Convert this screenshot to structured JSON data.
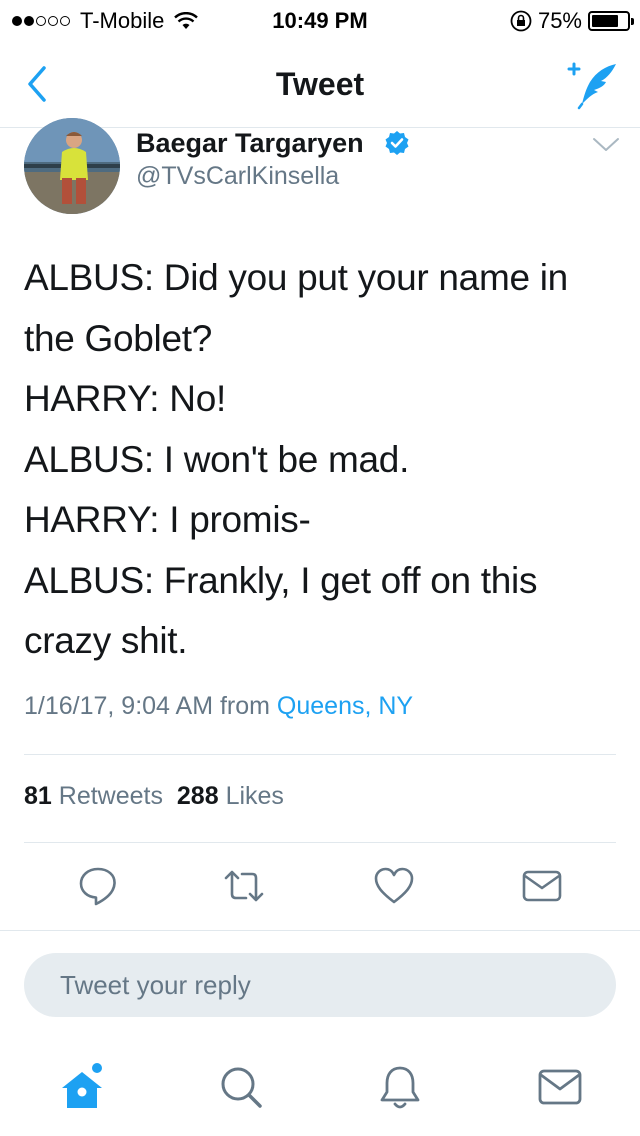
{
  "status_bar": {
    "carrier": "T-Mobile",
    "time": "10:49 PM",
    "battery": "75%",
    "signal_bars_filled": 2,
    "signal_bars_total": 5,
    "battery_level": 0.75
  },
  "nav": {
    "title": "Tweet",
    "back_icon": "chevron-left-icon",
    "compose_icon": "compose-tweet-icon"
  },
  "tweet": {
    "author_name": "Baegar Targaryen",
    "author_handle": "@TVsCarlKinsella",
    "verified": true,
    "text_lines": [
      "ALBUS: Did you put your name in",
      "the Goblet?",
      "HARRY: No!",
      "ALBUS: I won't be mad.",
      "HARRY: I promis-",
      "ALBUS: Frankly, I get off on this",
      "crazy shit."
    ],
    "timestamp": "1/16/17, 9:04 AM from ",
    "location": "Queens, NY",
    "retweets_count": "81",
    "retweets_label": "Retweets",
    "likes_count": "288",
    "likes_label": "Likes"
  },
  "reply": {
    "placeholder": "Tweet your reply"
  },
  "colors": {
    "accent": "#1da1f2",
    "secondary_text": "#657786",
    "divider": "#e1e8ed",
    "reply_bg": "#e6ecf0"
  },
  "tabs": [
    {
      "icon": "home-icon",
      "active": true,
      "has_notification_dot": true
    },
    {
      "icon": "search-icon",
      "active": false
    },
    {
      "icon": "notifications-bell-icon",
      "active": false
    },
    {
      "icon": "messages-envelope-icon",
      "active": false
    }
  ]
}
